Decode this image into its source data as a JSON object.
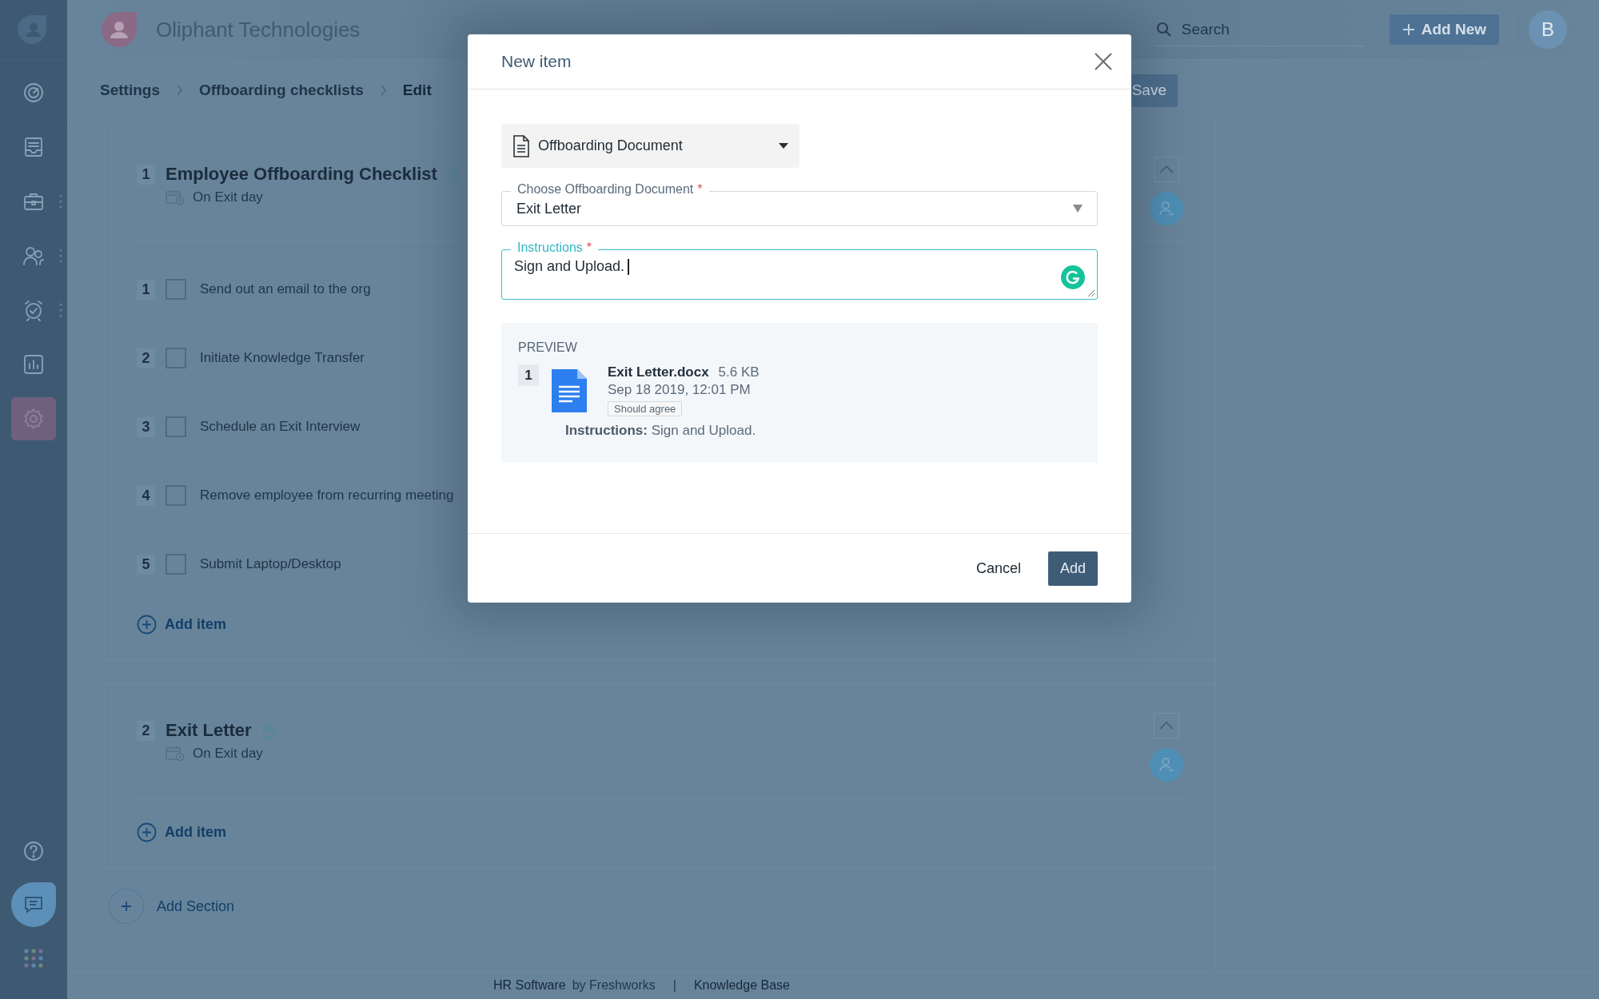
{
  "sidebar": {
    "items": [
      {
        "kind": "dashboard",
        "selected": false,
        "has_menu": false
      },
      {
        "kind": "inbox",
        "selected": false,
        "has_menu": false
      },
      {
        "kind": "briefcase",
        "selected": false,
        "has_menu": true
      },
      {
        "kind": "people",
        "selected": false,
        "has_menu": true
      },
      {
        "kind": "alarm",
        "selected": false,
        "has_menu": true
      },
      {
        "kind": "chart",
        "selected": false,
        "has_menu": false
      },
      {
        "kind": "settings",
        "selected": true,
        "has_menu": false
      }
    ],
    "bottom_items": [
      {
        "kind": "help"
      },
      {
        "kind": "chat"
      },
      {
        "kind": "apps"
      }
    ]
  },
  "topbar": {
    "company": "Oliphant Technologies",
    "search": {
      "placeholder": "Search"
    },
    "add_new_button": "Add New",
    "avatar_initial": "B"
  },
  "breadcrumb": [
    "Settings",
    "Offboarding checklists",
    "Edit"
  ],
  "save_button": "Save",
  "sections": [
    {
      "number": "1",
      "title": "Employee Offboarding Checklist",
      "schedule": "On Exit day",
      "items": [
        {
          "number": "1",
          "label": "Send out an email to the org",
          "checked": false
        },
        {
          "number": "2",
          "label": "Initiate Knowledge Transfer",
          "checked": false
        },
        {
          "number": "3",
          "label": "Schedule an Exit Interview",
          "checked": false
        },
        {
          "number": "4",
          "label": "Remove employee from recurring meeting",
          "checked": false
        },
        {
          "number": "5",
          "label": "Submit Laptop/Desktop",
          "checked": false
        }
      ],
      "add_item": "Add item"
    },
    {
      "number": "2",
      "title": "Exit Letter",
      "schedule": "On Exit day",
      "add_item": "Add item"
    }
  ],
  "add_section": "Add Section",
  "footer": {
    "product": "HR Software",
    "by": "by Freshworks",
    "separator": "|",
    "link": "Knowledge Base"
  },
  "modal": {
    "title": "New item",
    "type_select": {
      "value": "Offboarding Document"
    },
    "document_field": {
      "label": "Choose Offboarding Document",
      "required_mark": "*",
      "value": "Exit Letter"
    },
    "instructions_field": {
      "label": "Instructions",
      "required_mark": "*",
      "value": "Sign and Upload.",
      "focused": true
    },
    "preview": {
      "heading": "PREVIEW",
      "number": "1",
      "file_name": "Exit Letter.docx",
      "file_size": "5.6 KB",
      "date": "Sep 18 2019, 12:01 PM",
      "tag": "Should agree",
      "instructions": "**Instructions:** Sign and Upload."
    },
    "buttons": [
      {
        "label": "Cancel",
        "kind": "secondary"
      },
      {
        "label": "Add",
        "kind": "primary"
      }
    ]
  }
}
